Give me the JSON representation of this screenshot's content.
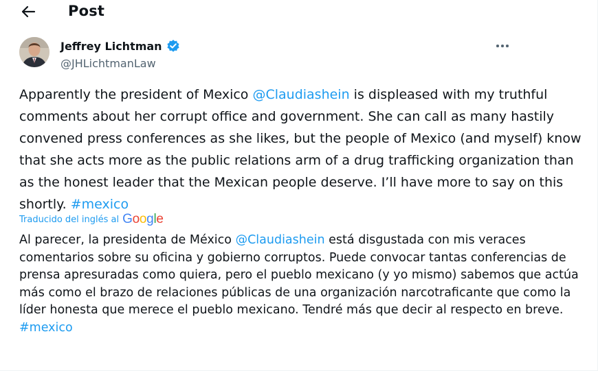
{
  "header": {
    "title": "Post",
    "back_icon": "arrow-left-icon"
  },
  "author": {
    "name": "Jeffrey Lichtman",
    "handle": "@JHLichtmanLaw",
    "verified_icon": "verified-badge-icon",
    "verified_color": "#1d9bf0"
  },
  "more_icon": "more-horizontal-icon",
  "tweet_en": {
    "part1": "Apparently the president of Mexico ",
    "mention": "@Claudiashein",
    "part2": " is displeased with my truthful comments about her corrupt office and government. She can call as many hastily convened press conferences as she likes, but the people of Mexico (and myself) know that she acts more as the public relations arm of a drug trafficking organization than as the honest leader that the Mexican people deserve. I’ll have more to say on this shortly. ",
    "hashtag": "#mexico"
  },
  "translation": {
    "label": "Traducido del inglés al",
    "provider": "Google"
  },
  "tweet_es": {
    "part1": "Al parecer, la presidenta de México ",
    "mention": "@Claudiashein",
    "part2": " está disgustada con mis veraces comentarios sobre su oficina y gobierno corruptos. Puede convocar tantas conferencias de prensa apresuradas como quiera, pero el pueblo mexicano (y yo mismo) sabemos que actúa más como el brazo de relaciones públicas de una organización narcotraficante que como la líder honesta que merece el pueblo mexicano. Tendré más que decir al respecto en breve. ",
    "hashtag": "#mexico"
  },
  "colors": {
    "link": "#1d9bf0",
    "text": "#0f1419",
    "secondary": "#536471"
  }
}
